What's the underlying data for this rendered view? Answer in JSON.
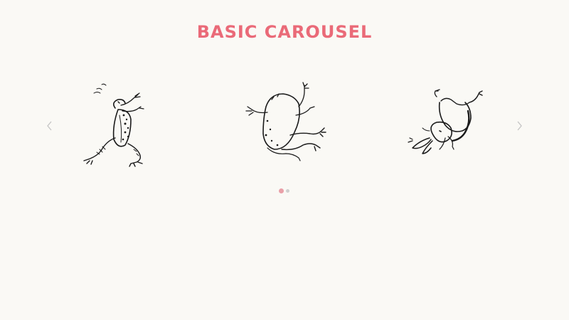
{
  "page": {
    "title": "BASIC CAROUSEL"
  },
  "carousel": {
    "prev_icon": "chevron-left-icon",
    "next_icon": "chevron-right-icon",
    "slides": [
      {
        "image": "frog-standing-ink-drawing"
      },
      {
        "image": "frog-lying-on-back-ink-drawing"
      },
      {
        "image": "rabbit-tumbling-ink-drawing"
      }
    ],
    "pagination": {
      "active_index": 0,
      "count": 2
    }
  },
  "colors": {
    "background": "#faf9f5",
    "accent": "#ea6a78",
    "dot_active": "#e9a0a8",
    "dot_inactive": "#cfcfcf",
    "arrow": "#c4c4c4",
    "ink": "#1a1a1a"
  }
}
